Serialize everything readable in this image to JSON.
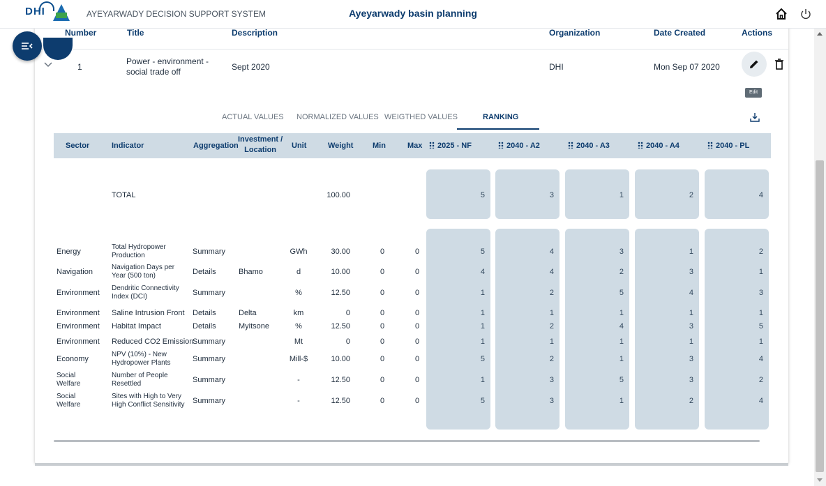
{
  "header": {
    "logo_text": "DHI",
    "app_name": "AYEYARWADY DECISION SUPPORT SYSTEM",
    "page_title": "Ayeyarwady basin planning"
  },
  "list": {
    "columns": {
      "number": "Number",
      "title": "Title",
      "description": "Description",
      "organization": "Organization",
      "date_created": "Date Created",
      "actions": "Actions"
    },
    "row": {
      "number": "1",
      "title_line1": "Power - environment -",
      "title_line2": "social trade off",
      "description": "Sept 2020",
      "organization": "DHI",
      "date_created": "Mon Sep 07 2020",
      "edit_tooltip": "Edit"
    }
  },
  "tabs": [
    "ACTUAL VALUES",
    "NORMALIZED VALUES",
    "WEIGTHED VALUES",
    "RANKING"
  ],
  "active_tab": "RANKING",
  "table": {
    "headers": {
      "sector": "Sector",
      "indicator": "Indicator",
      "aggregation": "Aggregation",
      "location_1": "Investment /",
      "location_2": "Location",
      "unit": "Unit",
      "weight": "Weight",
      "min": "Min",
      "max": "Max"
    },
    "alternatives": [
      "2025 - NF",
      "2040 - A2",
      "2040 - A3",
      "2040 - A4",
      "2040 - PL"
    ],
    "total": {
      "indicator": "TOTAL",
      "weight": "100.00",
      "ranks": [
        "5",
        "3",
        "1",
        "2",
        "4"
      ]
    },
    "rows": [
      {
        "sector": [
          "Energy"
        ],
        "indicator": [
          "Total Hydropower",
          "Production"
        ],
        "aggregation": "Summary",
        "location": "",
        "unit": "GWh",
        "weight": "30.00",
        "min": "0",
        "max": "0",
        "ranks": [
          "5",
          "4",
          "3",
          "1",
          "2"
        ]
      },
      {
        "sector": [
          "Navigation"
        ],
        "indicator": [
          "Navigation Days per",
          "Year (500 ton)"
        ],
        "aggregation": "Details",
        "location": "Bhamo",
        "unit": "d",
        "weight": "10.00",
        "min": "0",
        "max": "0",
        "ranks": [
          "4",
          "4",
          "2",
          "3",
          "1"
        ]
      },
      {
        "sector": [
          "Environment"
        ],
        "indicator": [
          "Dendritic Connectivity",
          "Index (DCI)"
        ],
        "aggregation": "Summary",
        "location": "",
        "unit": "%",
        "weight": "12.50",
        "min": "0",
        "max": "0",
        "ranks": [
          "1",
          "2",
          "5",
          "4",
          "3"
        ]
      },
      {
        "sector": [
          "Environment"
        ],
        "indicator": [
          "Saline Intrusion Front"
        ],
        "aggregation": "Details",
        "location": "Delta",
        "unit": "km",
        "weight": "0",
        "min": "0",
        "max": "0",
        "ranks": [
          "1",
          "1",
          "1",
          "1",
          "1"
        ]
      },
      {
        "sector": [
          "Environment"
        ],
        "indicator": [
          "Habitat Impact"
        ],
        "aggregation": "Details",
        "location": "Myitsone",
        "unit": "%",
        "weight": "12.50",
        "min": "0",
        "max": "0",
        "ranks": [
          "1",
          "2",
          "4",
          "3",
          "5"
        ]
      },
      {
        "sector": [
          "Environment"
        ],
        "indicator": [
          "Reduced CO2 Emission"
        ],
        "aggregation": "Summary",
        "location": "",
        "unit": "Mt",
        "weight": "0",
        "min": "0",
        "max": "0",
        "ranks": [
          "1",
          "1",
          "1",
          "1",
          "1"
        ]
      },
      {
        "sector": [
          "Economy"
        ],
        "indicator": [
          "NPV (10%) - New",
          "Hydropower Plants"
        ],
        "aggregation": "Summary",
        "location": "",
        "unit": "Mill-$",
        "weight": "10.00",
        "min": "0",
        "max": "0",
        "ranks": [
          "5",
          "2",
          "1",
          "3",
          "4"
        ]
      },
      {
        "sector": [
          "Social",
          "Welfare"
        ],
        "indicator": [
          "Number of People",
          "Resettled"
        ],
        "aggregation": "Summary",
        "location": "",
        "unit": "-",
        "weight": "12.50",
        "min": "0",
        "max": "0",
        "ranks": [
          "1",
          "3",
          "5",
          "3",
          "2"
        ]
      },
      {
        "sector": [
          "Social",
          "Welfare"
        ],
        "indicator": [
          "Sites with High to Very",
          "High Conflict Sensitivity"
        ],
        "aggregation": "Summary",
        "location": "",
        "unit": "-",
        "weight": "12.50",
        "min": "0",
        "max": "0",
        "ranks": [
          "5",
          "3",
          "1",
          "2",
          "4"
        ]
      }
    ]
  },
  "colors": {
    "primary": "#0d3c6e",
    "header_fill": "#cfdbe4",
    "rank_cell": "#cfdbe4"
  }
}
